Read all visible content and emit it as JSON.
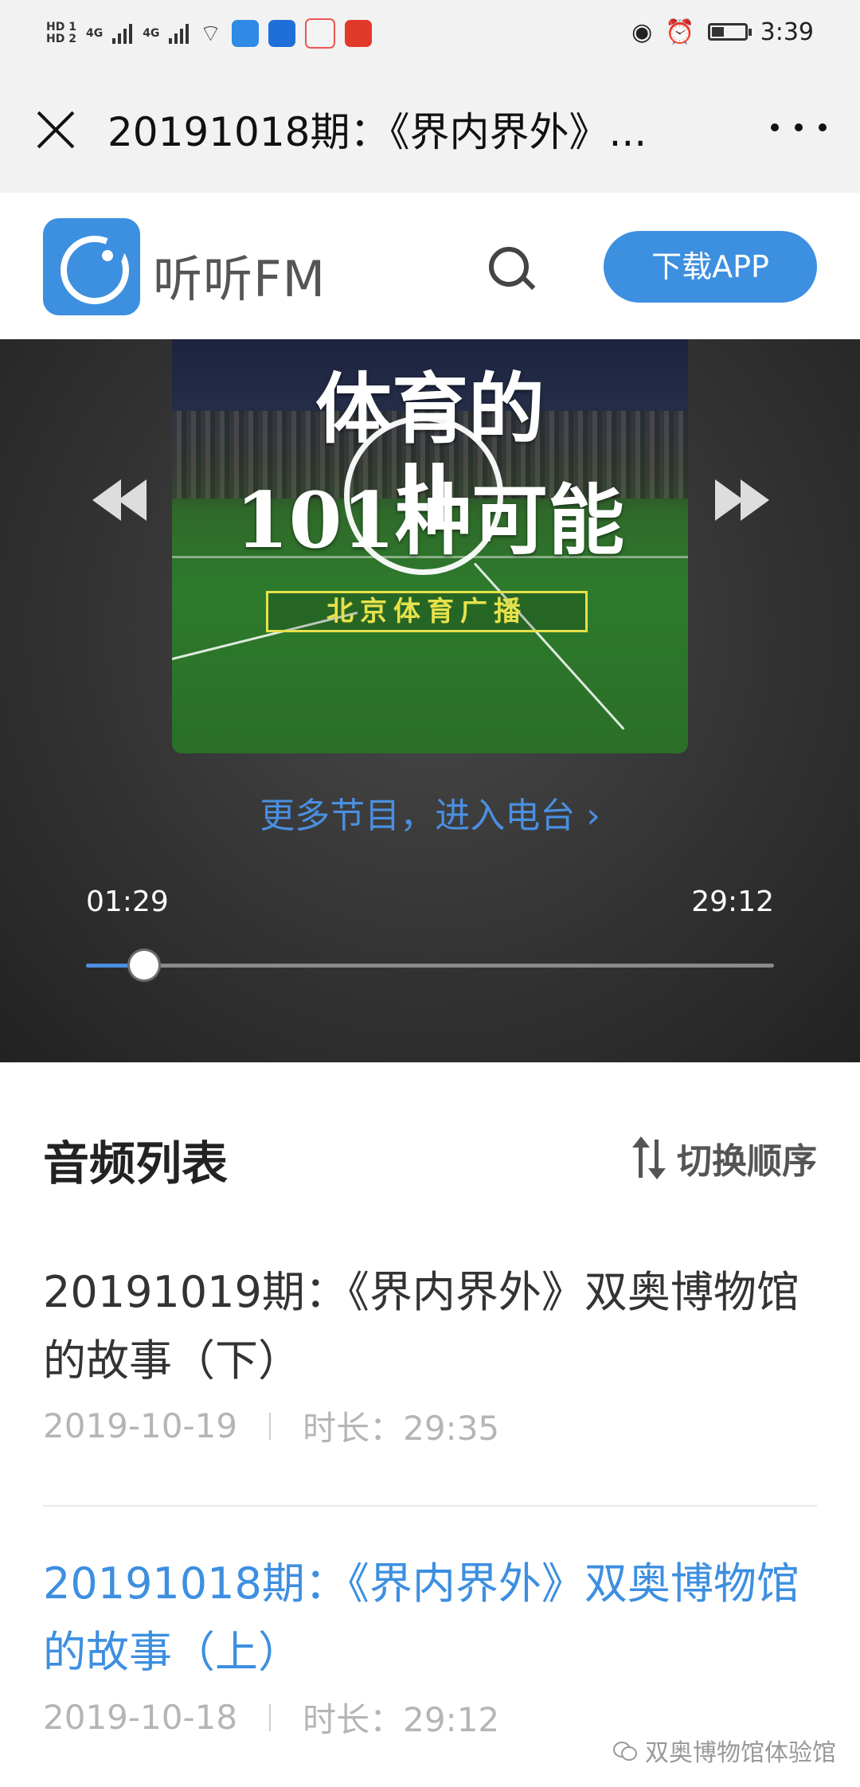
{
  "status_bar": {
    "time": "3:39",
    "hd1": "HD 1",
    "hd2": "HD 2",
    "net1": "4G",
    "net2": "4G",
    "battery_level": 0.35
  },
  "title_bar": {
    "title": "20191018期：《界内界外》..."
  },
  "app_header": {
    "brand": "听听FM",
    "download_label": "下载APP",
    "accent_color": "#3d8fe0"
  },
  "player": {
    "cover_line1": "体育的",
    "cover_line2": "101种可能",
    "cover_badge": "北京体育广播",
    "more_link": "更多节目，进入电台 ›",
    "elapsed": "01:29",
    "duration": "29:12",
    "progress": 0.085
  },
  "list": {
    "heading": "音频列表",
    "sort_label": "切换顺序",
    "episodes": [
      {
        "title": "20191019期：《界内界外》双奥博物馆的故事（下）",
        "date": "2019-10-19",
        "length": "时长：29:35",
        "active": false
      },
      {
        "title": "20191018期：《界内界外》双奥博物馆的故事（上）",
        "date": "2019-10-18",
        "length": "时长：29:12",
        "active": true
      }
    ]
  },
  "watermark": "双奥博物馆体验馆"
}
